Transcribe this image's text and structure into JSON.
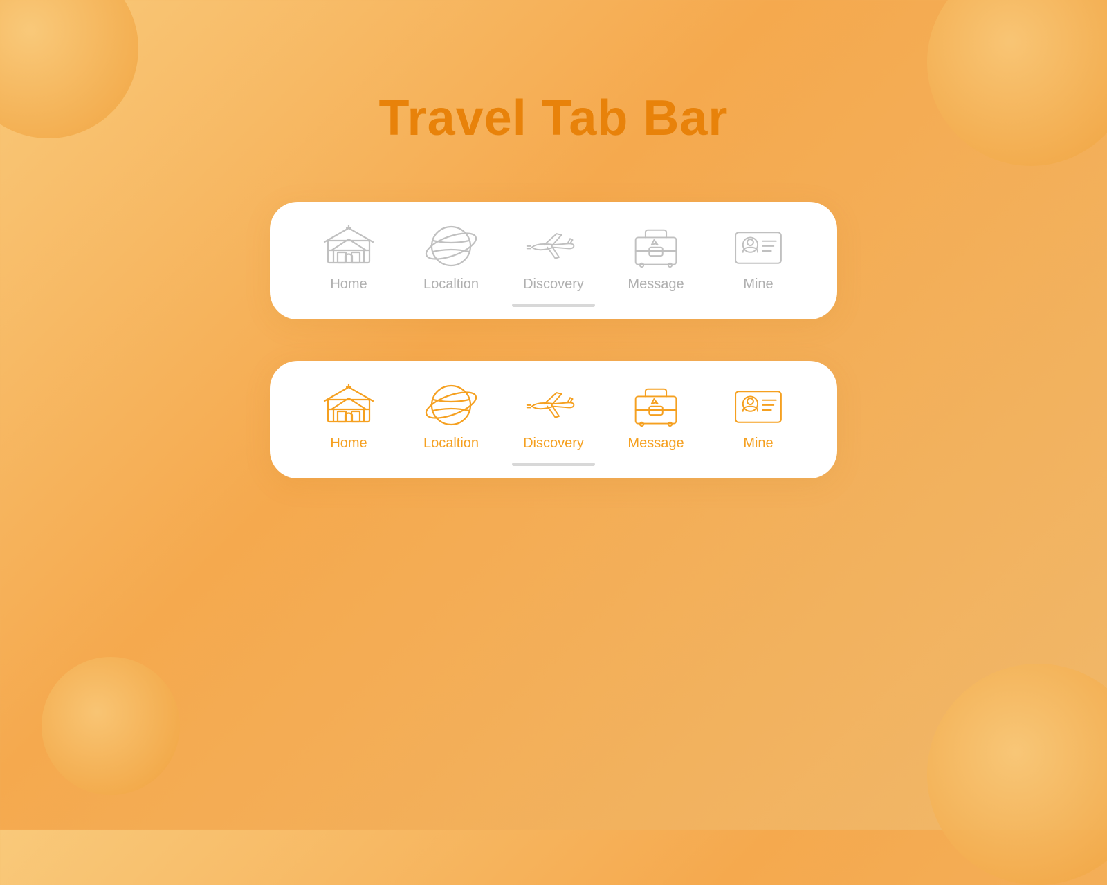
{
  "page": {
    "title": "Travel Tab Bar",
    "background_gradient_start": "#f9c97a",
    "background_gradient_end": "#f0b86a",
    "accent_color": "#f5a020",
    "title_color": "#e8820a"
  },
  "tab_bars": [
    {
      "id": "inactive",
      "variant": "inactive",
      "items": [
        {
          "id": "home",
          "label": "Home"
        },
        {
          "id": "location",
          "label": "Localtion"
        },
        {
          "id": "discovery",
          "label": "Discovery"
        },
        {
          "id": "message",
          "label": "Message"
        },
        {
          "id": "mine",
          "label": "Mine"
        }
      ]
    },
    {
      "id": "active",
      "variant": "active",
      "items": [
        {
          "id": "home",
          "label": "Home"
        },
        {
          "id": "location",
          "label": "Localtion"
        },
        {
          "id": "discovery",
          "label": "Discovery"
        },
        {
          "id": "message",
          "label": "Message"
        },
        {
          "id": "mine",
          "label": "Mine"
        }
      ]
    }
  ]
}
